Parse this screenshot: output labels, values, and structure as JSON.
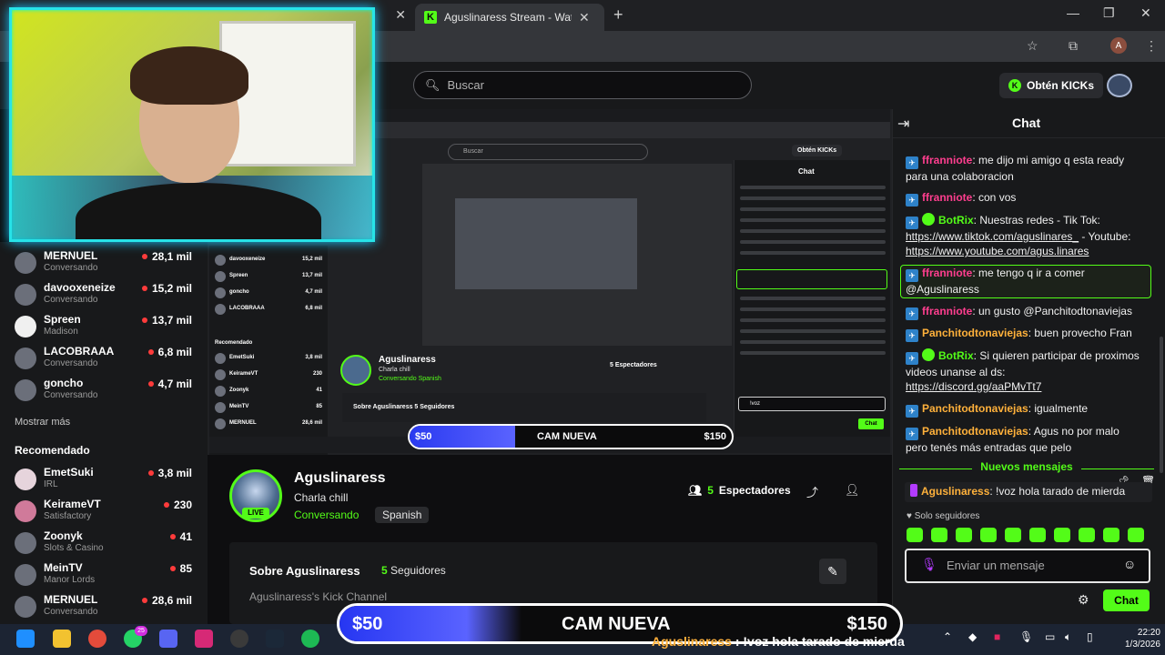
{
  "browser": {
    "active_tab_title": "Aguslinaress Stream - Watch Li",
    "tab_close": "✕",
    "new_tab": "+",
    "window_controls": [
      "—",
      "❐",
      "✕"
    ],
    "profile_letter": "A"
  },
  "header": {
    "search_placeholder": "Buscar",
    "kicks_button": "Obtén KICKs"
  },
  "sidebar": {
    "following": [
      {
        "name": "MERNUEL",
        "sub": "Conversando",
        "count": "28,1 mil"
      },
      {
        "name": "davooxeneize",
        "sub": "Conversando",
        "count": "15,2 mil"
      },
      {
        "name": "Spreen",
        "sub": "Madison",
        "count": "13,7 mil"
      },
      {
        "name": "LACOBRAAA",
        "sub": "Conversando",
        "count": "6,8 mil"
      },
      {
        "name": "goncho",
        "sub": "Conversando",
        "count": "4,7 mil"
      }
    ],
    "show_more": "Mostrar más",
    "recommended_title": "Recomendado",
    "recommended": [
      {
        "name": "EmetSuki",
        "sub": "IRL",
        "count": "3,8 mil"
      },
      {
        "name": "KeirameVT",
        "sub": "Satisfactory",
        "count": "230"
      },
      {
        "name": "Zoonyk",
        "sub": "Slots & Casino",
        "count": "41"
      },
      {
        "name": "MeinTV",
        "sub": "Manor Lords",
        "count": "85"
      },
      {
        "name": "MERNUEL",
        "sub": "Conversando",
        "count": "28,6 mil"
      }
    ]
  },
  "stream": {
    "streamer": "Aguslinaress",
    "title": "Charla chill",
    "category": "Conversando",
    "language": "Spanish",
    "live_badge": "LIVE",
    "spectators_num": "5",
    "spectators_label": "Espectadores",
    "about_title": "Sobre Aguslinaress",
    "followers_num": "5",
    "followers_label": "Seguidores",
    "about_desc": "Aguslinaress's Kick Channel"
  },
  "inner_stream": {
    "search": "Buscar",
    "kicks": "Obtén KICKs",
    "chat_title": "Chat",
    "chat_input": "!voz",
    "send": "Chat",
    "streamer": "Aguslinaress",
    "title": "Charla chill",
    "category": "Conversando  Spanish",
    "spectators": "5 Espectadores",
    "about": "Sobre Aguslinaress  5 Seguidores",
    "sidebar_names": [
      "davooxeneize",
      "Spreen",
      "goncho",
      "LACOBRAAA",
      "Recomendado",
      "EmetSuki",
      "KeirameVT",
      "Zoonyk",
      "MeinTV",
      "MERNUEL"
    ],
    "sidebar_counts": [
      "15,2 mil",
      "13,7 mil",
      "4,7 mil",
      "6,8 mil",
      "",
      "3,8 mil",
      "230",
      "41",
      "85",
      "28,6 mil"
    ],
    "overlay_amount": "$50",
    "overlay_title": "CAM NUEVA",
    "overlay_goal": "$150"
  },
  "chat": {
    "title": "Chat",
    "messages": [
      {
        "user": "ffranniote",
        "user_class": "u-fran",
        "text": ": me dijo mi amigo q esta ready para una colaboracion"
      },
      {
        "user": "ffranniote",
        "user_class": "u-fran",
        "text": ": con vos"
      },
      {
        "user": "BotRix",
        "user_class": "u-bot",
        "text": ": Nuestras redes - Tik Tok: ",
        "link1": "https://www.tiktok.com/aguslinares_",
        "mid": " - Youtube: ",
        "link2": "https://www.youtube.com/agus.linares"
      },
      {
        "user": "ffranniote",
        "user_class": "u-fran",
        "text": ": me tengo q ir a comer @Aguslinaress"
      },
      {
        "user": "ffranniote",
        "user_class": "u-fran",
        "text": ": un gusto @Panchitodtonaviejas"
      },
      {
        "user": "Panchitodtonaviejas",
        "user_class": "u-pan",
        "text": ": buen provecho Fran"
      },
      {
        "user": "BotRix",
        "user_class": "u-bot",
        "text": ": Si quieren participar de proximos videos unanse al ds: ",
        "link1": "https://discord.gg/aaPMvTt7"
      },
      {
        "user": "Panchitodtonaviejas",
        "user_class": "u-pan",
        "text": ": igualmente"
      },
      {
        "user": "Panchitodtonaviejas",
        "user_class": "u-pan",
        "text": ": Agus no por malo pero tenés más entradas que pelo"
      }
    ],
    "new_messages": "Nuevos mensajes",
    "pinned_user": "Aguslinaress",
    "pinned_text": ": !voz hola tarado de mierda",
    "followers_only": "Solo seguidores",
    "input_placeholder": "Enviar un mensaje",
    "send_button": "Chat"
  },
  "overlay": {
    "amount": "$50",
    "title": "CAM NUEVA",
    "goal": "$150",
    "progress_fraction": 0.33,
    "ticker_user": "Aguslinaress",
    "ticker_text": " : !voz hola tarado de mierda"
  },
  "taskbar": {
    "notification_badge": "25",
    "time": "22:20",
    "date": "1/3/2026"
  },
  "colors": {
    "kick_green": "#53fc18",
    "webcam_border": "#27e3e8",
    "overlay_blue": "#2636f2"
  }
}
